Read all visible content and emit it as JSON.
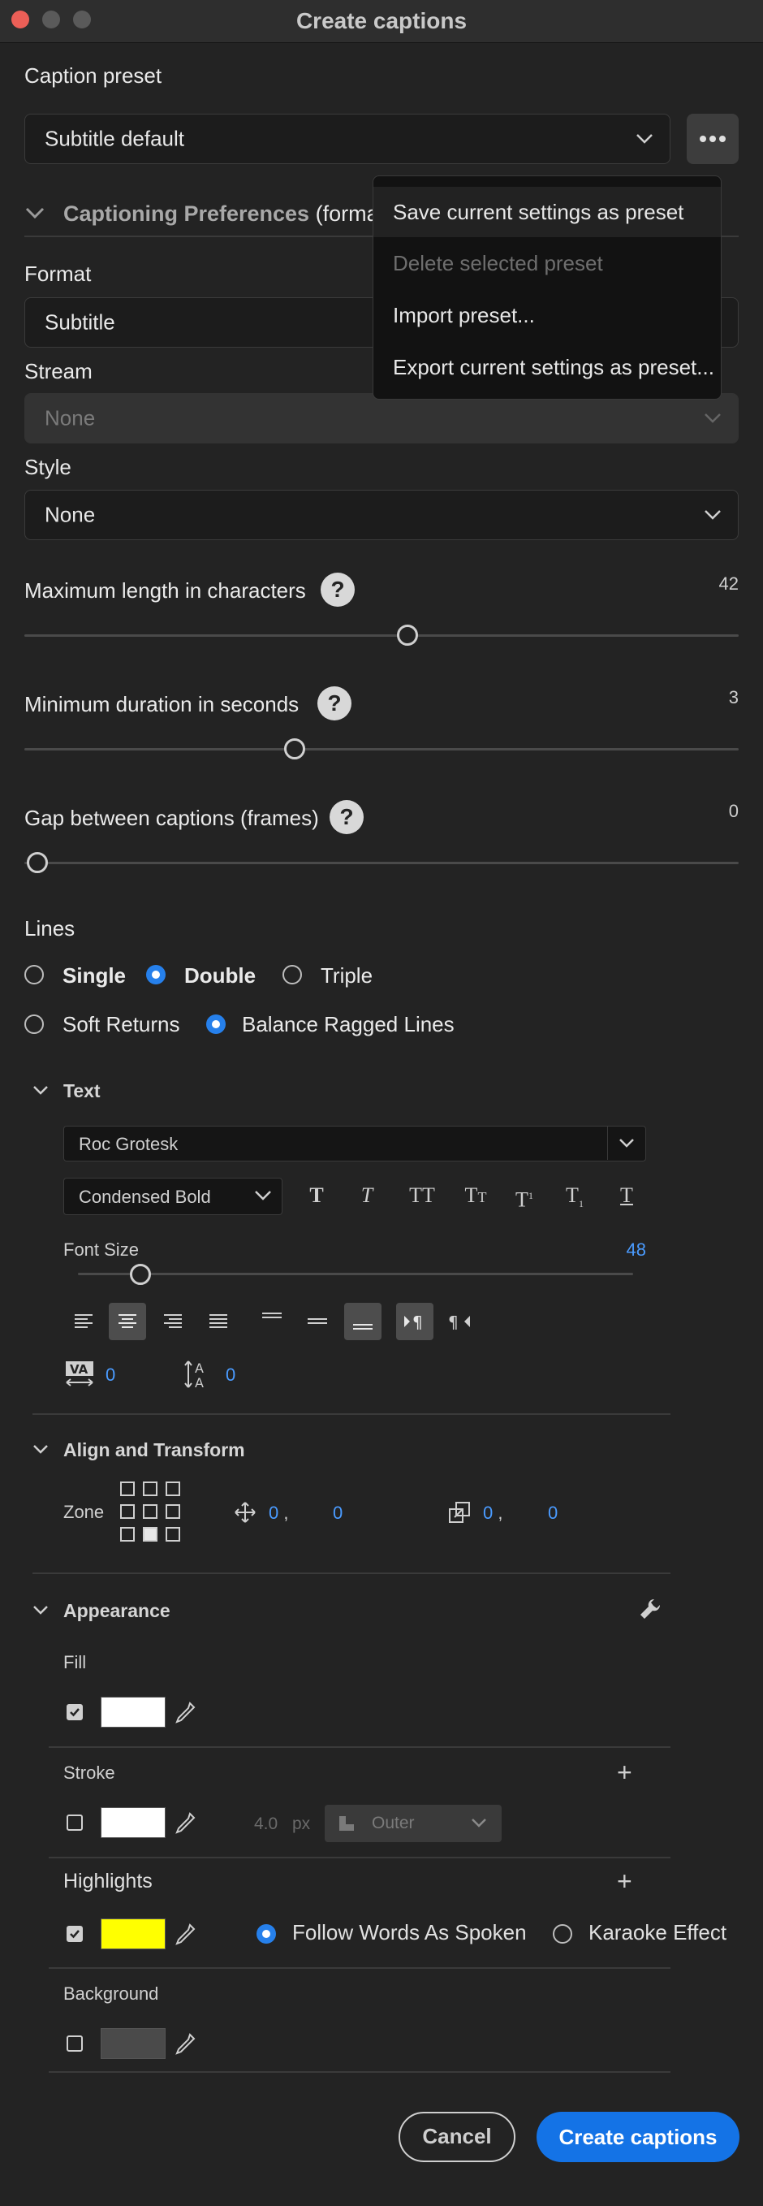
{
  "window": {
    "title": "Create captions"
  },
  "caption_preset": {
    "label": "Caption preset",
    "value": "Subtitle default"
  },
  "preset_menu": {
    "items": [
      "Save current settings as preset",
      "Delete selected preset",
      "Import preset...",
      "Export current settings as preset..."
    ]
  },
  "captioning_prefs": {
    "title": "Captioning Preferences",
    "title_suffix": "(format,"
  },
  "format": {
    "label": "Format",
    "value": "Subtitle"
  },
  "stream": {
    "label": "Stream",
    "value": "None"
  },
  "style": {
    "label": "Style",
    "value": "None"
  },
  "max_length": {
    "label": "Maximum length in characters",
    "value": "42",
    "fraction": 0.54
  },
  "min_duration": {
    "label": "Minimum duration in seconds",
    "value": "3",
    "fraction": 0.38
  },
  "gap": {
    "label": "Gap between captions (frames)",
    "value": "0",
    "fraction": 0.0
  },
  "lines": {
    "label": "Lines",
    "options": [
      "Single",
      "Double",
      "Triple"
    ],
    "selected": "Double",
    "wrap_options": [
      "Soft Returns",
      "Balance Ragged Lines"
    ],
    "wrap_selected": "Balance Ragged Lines"
  },
  "text": {
    "section": "Text",
    "font": "Roc Grotesk",
    "weight": "Condensed Bold",
    "font_size_label": "Font Size",
    "font_size": "48",
    "font_size_fraction": 0.12,
    "tracking": "0",
    "leading": "0"
  },
  "align_transform": {
    "section": "Align and Transform",
    "zone_label": "Zone",
    "pos_x": "0",
    "pos_y": "0",
    "scale_x": "0",
    "scale_y": "0"
  },
  "appearance": {
    "section": "Appearance",
    "fill": {
      "label": "Fill",
      "color": "#ffffff",
      "checked": true
    },
    "stroke": {
      "label": "Stroke",
      "color": "#ffffff",
      "checked": false,
      "width": "4.0",
      "unit": "px",
      "position": "Outer"
    },
    "highlights": {
      "label": "Highlights",
      "color": "#ffff00",
      "checked": true,
      "options": [
        "Follow Words As Spoken",
        "Karaoke Effect"
      ],
      "selected": "Follow Words As Spoken"
    },
    "background": {
      "label": "Background",
      "color": "#4a4a4a",
      "checked": false
    }
  },
  "actions": {
    "cancel": "Cancel",
    "create": "Create captions"
  },
  "colors": {
    "accent": "#2680eb",
    "close": "#ec5f57"
  }
}
